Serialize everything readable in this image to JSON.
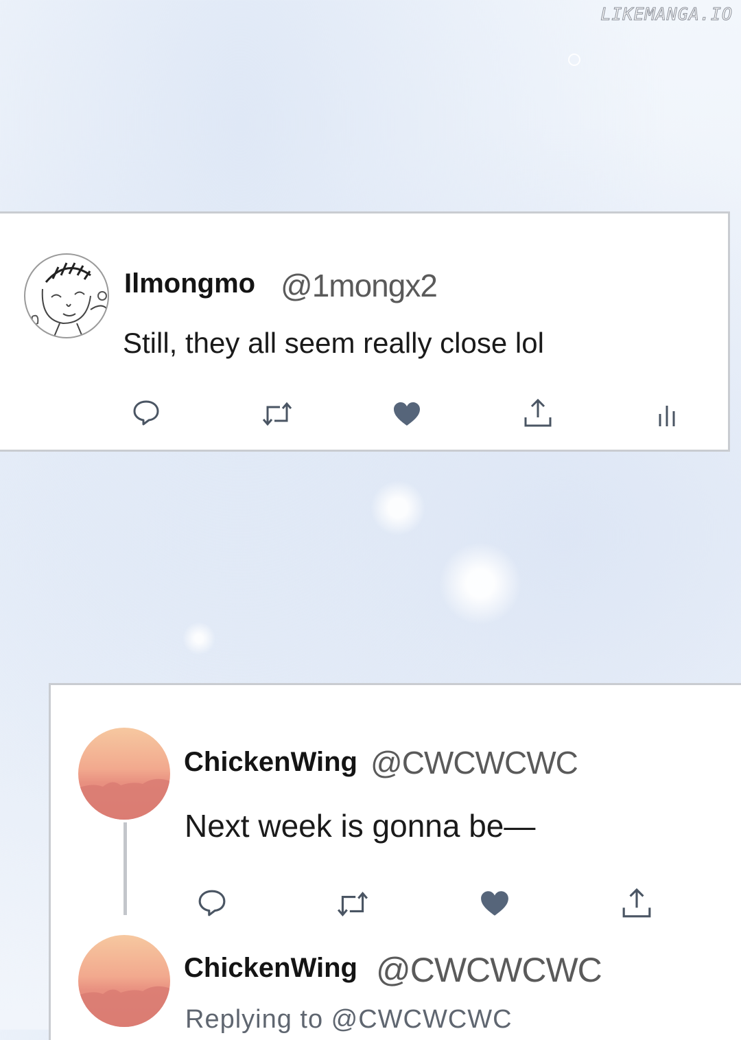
{
  "watermark": "LIKEMANGA.IO",
  "tweets": [
    {
      "name": "Ilmongmo",
      "handle": "@1mongx2",
      "text": "Still, they all seem really close lol",
      "avatar": "sketch-avatar"
    },
    {
      "name": "ChickenWing",
      "handle": "@CWCWCWC",
      "text": "Next week is gonna be—",
      "avatar": "sunset-avatar"
    },
    {
      "name": "ChickenWing",
      "handle": "@CWCWCWC",
      "replying_to": "Replying to @CWCWCWC",
      "avatar": "sunset-avatar"
    }
  ],
  "actions": {
    "icons": [
      "reply-icon",
      "retweet-icon",
      "like-icon",
      "share-icon",
      "analytics-icon"
    ],
    "icon_color": "#4a5563",
    "like_color": "#56657a"
  },
  "colors": {
    "card_border": "#c9ccd1",
    "name": "#141414",
    "handle": "#5a5a5a"
  }
}
